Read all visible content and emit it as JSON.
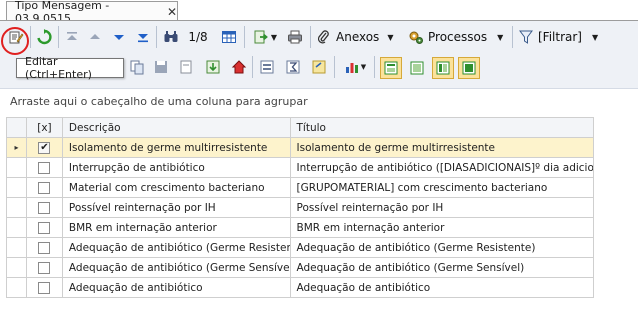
{
  "tab": {
    "title": "Tipo Mensagem - 03.9.0515",
    "close": "✕"
  },
  "toolbar": {
    "record_counter": "1/8",
    "anexos_label": "Anexos",
    "processos_label": "Processos",
    "filtrar_label": "[Filtrar]"
  },
  "tooltip": {
    "text": "Editar (Ctrl+Enter)"
  },
  "group_panel": {
    "text": "Arraste aqui o cabeçalho de uma coluna para agrupar"
  },
  "grid": {
    "headers": {
      "check": "[x]",
      "descricao": "Descrição",
      "titulo": "Título"
    },
    "rows": [
      {
        "checked": true,
        "selected": true,
        "indicator": "▸",
        "check_mark": "✔",
        "descricao": "Isolamento de germe multirresistente",
        "titulo": "Isolamento de germe multirresistente"
      },
      {
        "checked": false,
        "selected": false,
        "indicator": "",
        "check_mark": "",
        "descricao": "Interrupção de antibiótico",
        "titulo": "Interrupção de antibiótico ([DIASADICIONAIS]º dia adicional)"
      },
      {
        "checked": false,
        "selected": false,
        "indicator": "",
        "check_mark": "",
        "descricao": "Material com crescimento bacteriano",
        "titulo": "[GRUPOMATERIAL] com crescimento bacteriano"
      },
      {
        "checked": false,
        "selected": false,
        "indicator": "",
        "check_mark": "",
        "descricao": "Possível reinternação por IH",
        "titulo": "Possível reinternação por IH"
      },
      {
        "checked": false,
        "selected": false,
        "indicator": "",
        "check_mark": "",
        "descricao": "BMR em internação anterior",
        "titulo": "BMR em internação anterior"
      },
      {
        "checked": false,
        "selected": false,
        "indicator": "",
        "check_mark": "",
        "descricao": "Adequação de antibiótico (Germe Resistente)",
        "titulo": "Adequação de antibiótico (Germe Resistente)"
      },
      {
        "checked": false,
        "selected": false,
        "indicator": "",
        "check_mark": "",
        "descricao": "Adequação de antibiótico (Germe Sensível)",
        "titulo": "Adequação de antibiótico (Germe Sensível)"
      },
      {
        "checked": false,
        "selected": false,
        "indicator": "",
        "check_mark": "",
        "descricao": "Adequação de antibiótico",
        "titulo": "Adequação de antibiótico"
      }
    ]
  },
  "colors": {
    "selected_row": "#fdf3cc",
    "toolbar_bg": "#eef1f6",
    "highlight_circle": "#e02020"
  }
}
